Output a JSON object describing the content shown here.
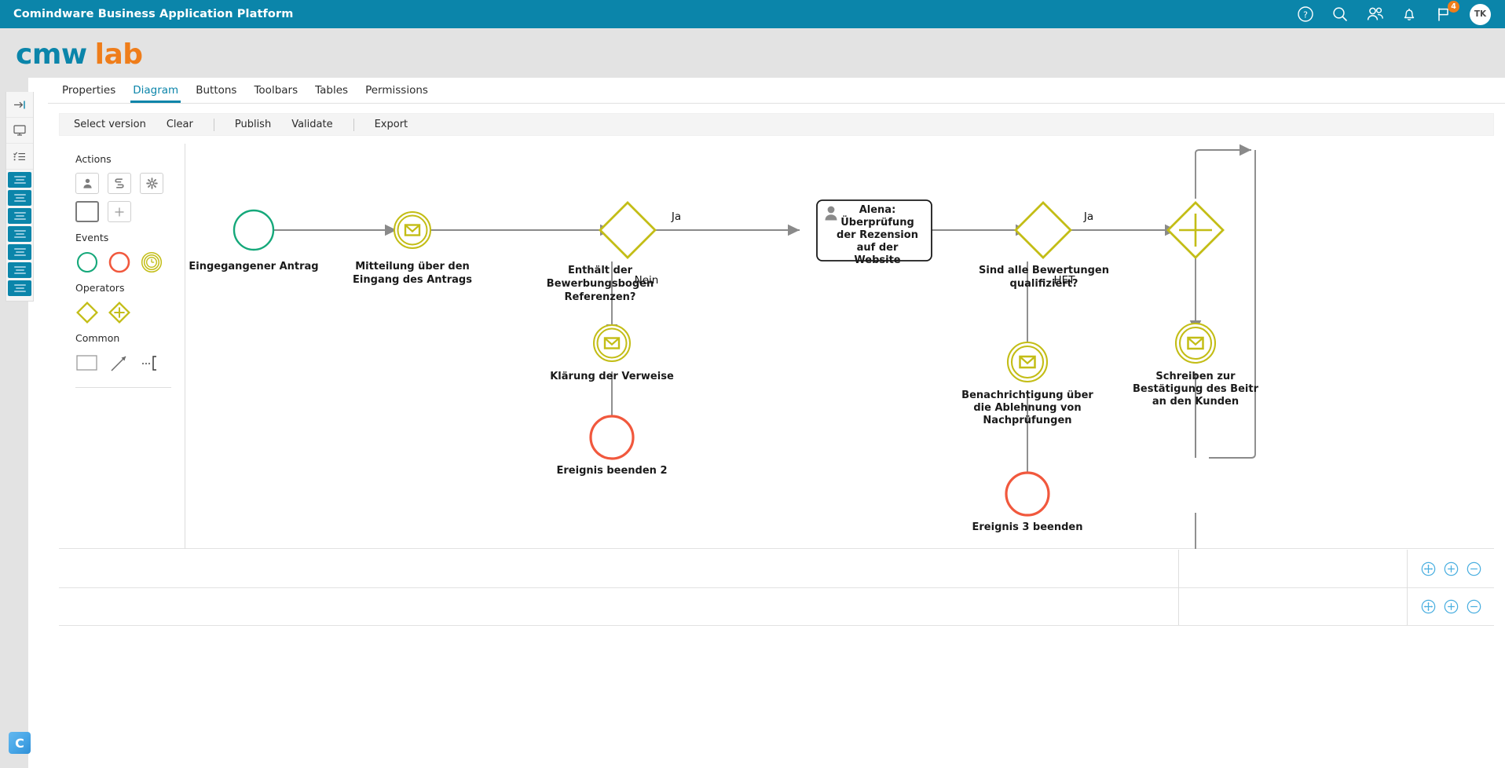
{
  "topbar": {
    "title": "Comindware Business Application Platform",
    "icons": [
      {
        "name": "help-icon",
        "label": "Help"
      },
      {
        "name": "search-icon",
        "label": "Search"
      },
      {
        "name": "people-icon",
        "label": "People"
      },
      {
        "name": "bell-icon",
        "label": "Notifications"
      },
      {
        "name": "flag-icon",
        "label": "Flags"
      }
    ],
    "flag_badge": "4",
    "avatar_initials": "TK",
    "background_color": "#0b85aa"
  },
  "logo": {
    "part1": "cmw",
    "part2": "lab",
    "color1": "#0b85aa",
    "color2": "#ef7d1a"
  },
  "corner_logo": {
    "letter": "C"
  },
  "tabs": [
    {
      "label": "Properties",
      "active": false
    },
    {
      "label": "Diagram",
      "active": true
    },
    {
      "label": "Buttons",
      "active": false
    },
    {
      "label": "Toolbars",
      "active": false
    },
    {
      "label": "Tables",
      "active": false
    },
    {
      "label": "Permissions",
      "active": false
    }
  ],
  "toolbar": {
    "items": [
      "Select version",
      "Clear",
      "Publish",
      "Validate",
      "Export"
    ]
  },
  "palette": {
    "sections": [
      {
        "title": "Actions"
      },
      {
        "title": "Events"
      },
      {
        "title": "Operators"
      },
      {
        "title": "Common"
      }
    ],
    "action_icons": [
      "user-task-icon",
      "script-task-icon",
      "service-task-icon",
      "empty-task-icon",
      "add-task-icon"
    ],
    "event_icons": [
      "start-event-icon",
      "end-event-icon",
      "timer-event-icon"
    ],
    "operator_icons": [
      "exclusive-gateway-icon",
      "parallel-gateway-icon"
    ],
    "common_icons": [
      "rectangle-icon",
      "arrow-icon",
      "bracket-icon"
    ]
  },
  "diagram": {
    "nodes": [
      {
        "id": "n1",
        "type": "start-event",
        "label": "Eingegangener Antrag"
      },
      {
        "id": "n2",
        "type": "message-event",
        "label": "Mitteilung über den\nEingang des Antrags",
        "line1": "Mitteilung über den",
        "line2": "Eingang des Antrags"
      },
      {
        "id": "n3",
        "type": "exclusive-gateway",
        "line1": "Enthält der",
        "line2": "Bewerbungsbogen",
        "line3": "Referenzen?"
      },
      {
        "id": "n4",
        "type": "user-task",
        "assignee": "Alena:",
        "line1": "Alena:",
        "line2": "Überprüfung",
        "line3": "der Rezension",
        "line4": "auf der",
        "line5": "Website"
      },
      {
        "id": "n5",
        "type": "exclusive-gateway",
        "line1": "Sind alle Bewertungen",
        "line2": "qualifiziert?"
      },
      {
        "id": "n6",
        "type": "parallel-gateway",
        "label": ""
      },
      {
        "id": "n7",
        "type": "message-event",
        "label": "Klärung der Verweise"
      },
      {
        "id": "n8",
        "type": "end-event",
        "label": "Ereignis beenden 2"
      },
      {
        "id": "n9",
        "type": "message-event",
        "line1": "Benachrichtigung über",
        "line2": "die Ablehnung von",
        "line3": "Nachprüfungen"
      },
      {
        "id": "n10",
        "type": "end-event",
        "label": "Ereignis 3 beenden"
      },
      {
        "id": "n11",
        "type": "message-event",
        "line1": "Schreiben zur",
        "line2": "Bestätigung des Beitr",
        "line3": "an den Kunden"
      }
    ],
    "edge_labels": [
      {
        "id": "e1",
        "text": "Ja"
      },
      {
        "id": "e2",
        "text": "Nein"
      },
      {
        "id": "e3",
        "text": "Ja"
      },
      {
        "id": "e4",
        "text": "HET"
      }
    ],
    "colors": {
      "start": "#15a87a",
      "end": "#f1583d",
      "message": "#c3bd16",
      "gateway": "#c3bd16",
      "flow": "#8a8a8a",
      "task_border": "#1a1a1a"
    }
  },
  "bottom_panes": {
    "zoom_controls": [
      "fit-icon",
      "zoom-in-icon",
      "zoom-out-icon"
    ],
    "control_color": "#4aafe0"
  }
}
